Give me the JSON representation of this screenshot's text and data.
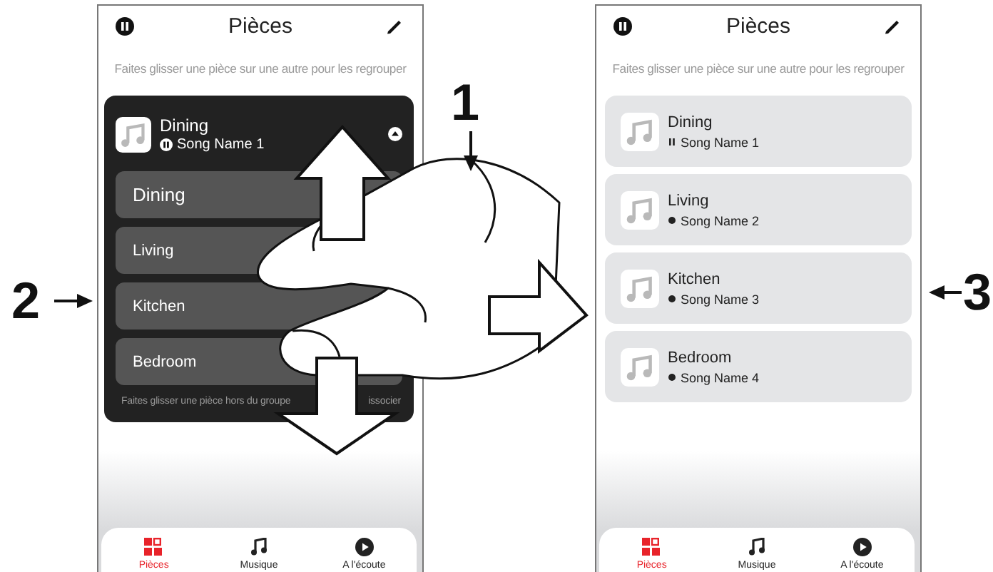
{
  "screens": [
    {
      "title": "Pièces",
      "hint": "Faites glisser une pièce sur une autre pour les regrouper",
      "group": {
        "name": "Dining",
        "song": "Song Name 1",
        "playing": true,
        "rooms": [
          "Dining",
          "Living",
          "Kitchen",
          "Bedroom"
        ],
        "hint_start": "Faites glisser une pièce hors du groupe",
        "hint_end": "issocier"
      },
      "tabs": [
        {
          "kind": "rooms",
          "label": "Pièces",
          "selected": true
        },
        {
          "kind": "music",
          "label": "Musique",
          "selected": false
        },
        {
          "kind": "now-playing",
          "label": "A l'écoute",
          "selected": false
        }
      ]
    },
    {
      "title": "Pièces",
      "hint": "Faites glisser une pièce sur une autre pour les regrouper",
      "rooms": [
        {
          "name": "Dining",
          "song": "Song Name 1",
          "playing": true
        },
        {
          "name": "Living",
          "song": "Song Name 2",
          "playing": false
        },
        {
          "name": "Kitchen",
          "song": "Song Name 3",
          "playing": false
        },
        {
          "name": "Bedroom",
          "song": "Song Name 4",
          "playing": false
        }
      ],
      "tabs": [
        {
          "kind": "rooms",
          "label": "Pièces",
          "selected": true
        },
        {
          "kind": "music",
          "label": "Musique",
          "selected": false
        },
        {
          "kind": "now-playing",
          "label": "A l'écoute",
          "selected": false
        }
      ]
    }
  ],
  "callouts": [
    {
      "label": "1"
    },
    {
      "label": "2"
    },
    {
      "label": "3"
    }
  ]
}
